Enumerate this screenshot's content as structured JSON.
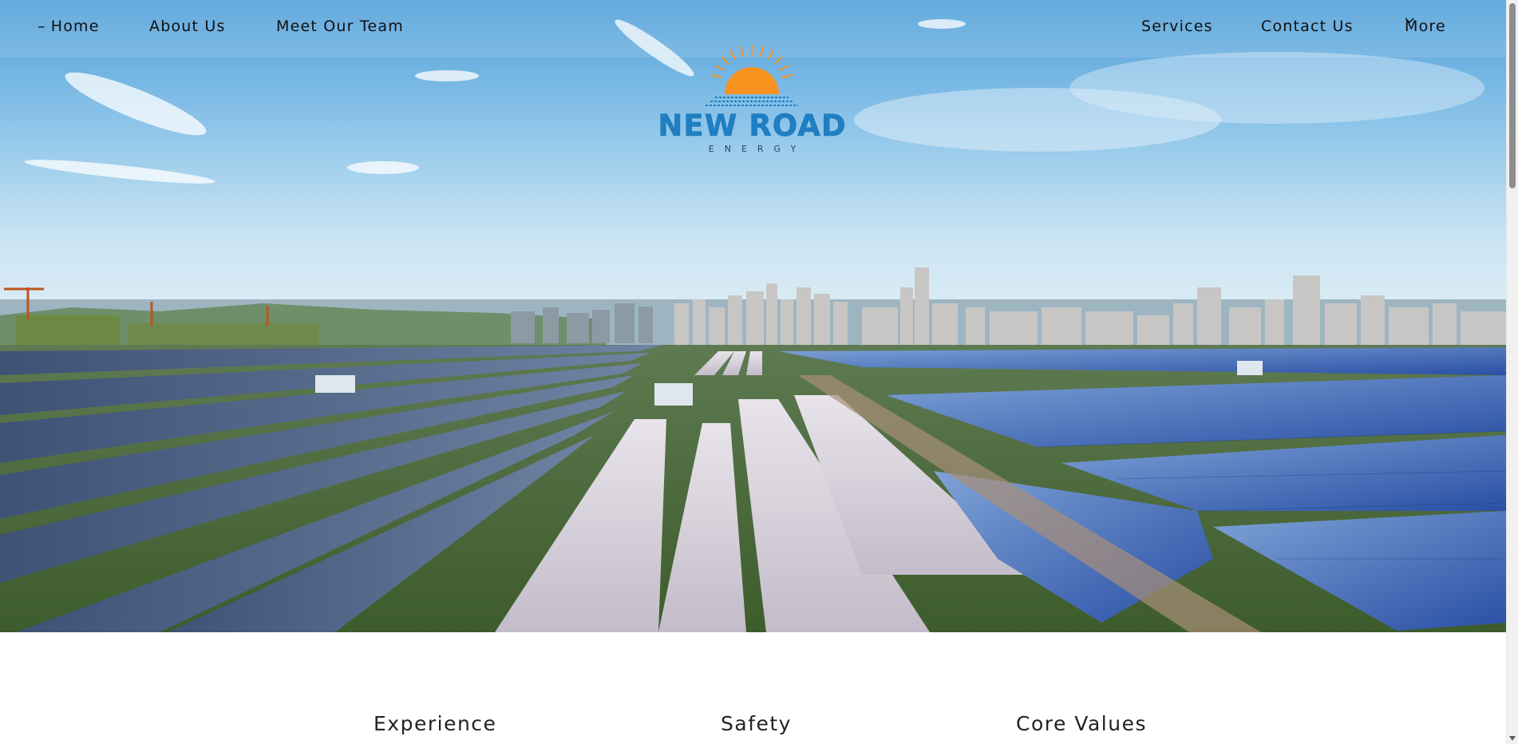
{
  "nav": {
    "home": "Home",
    "home_prefix": "–",
    "about": "About Us",
    "team": "Meet Our Team",
    "services": "Services",
    "contact": "Contact Us",
    "more": "More"
  },
  "logo": {
    "name": "NEW ROAD",
    "tagline": "ENERGY"
  },
  "features": {
    "experience": "Experience",
    "safety": "Safety",
    "core_values": "Core Values"
  },
  "colors": {
    "brand_blue": "#1f7fc2",
    "sun_orange": "#f7931e",
    "nav_text": "#111111"
  },
  "icons": {
    "more_dropdown": "chevron-down-icon",
    "logo_sun": "sun-icon"
  },
  "hero": {
    "image": "solar-farm-city-skyline"
  }
}
